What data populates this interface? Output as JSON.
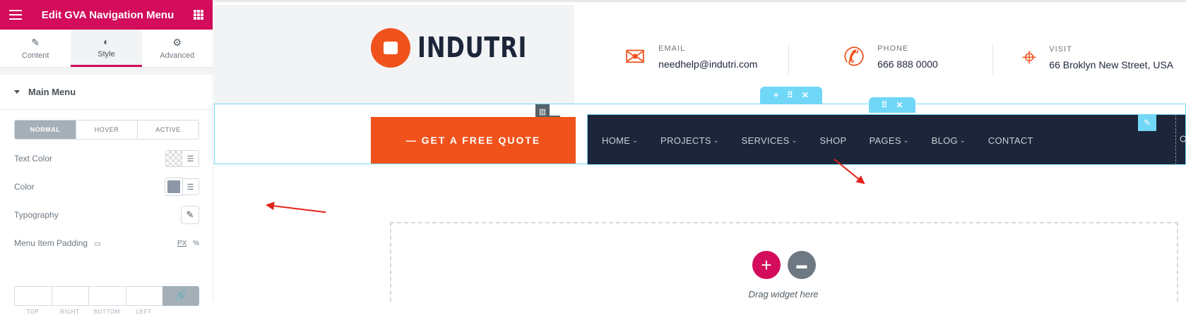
{
  "panel": {
    "title": "Edit GVA Navigation Menu",
    "tabs": [
      {
        "label": "Content",
        "icon": "pencil-icon"
      },
      {
        "label": "Style",
        "icon": "contrast-icon"
      },
      {
        "label": "Advanced",
        "icon": "gear-icon"
      }
    ],
    "section_title": "Main Menu",
    "state_tabs": [
      "NORMAL",
      "HOVER",
      "ACTIVE"
    ],
    "controls": {
      "text_color": "Text Color",
      "color": "Color",
      "typography": "Typography",
      "menu_item_padding": "Menu Item Padding",
      "unit_px": "PX",
      "unit_pct": "%"
    },
    "padding_labels": [
      "TOP",
      "RIGHT",
      "BOTTOM",
      "LEFT"
    ]
  },
  "preview": {
    "logo_text": "INDUTRI",
    "email": {
      "label": "EMAIL",
      "value": "needhelp@indutri.com"
    },
    "phone": {
      "label": "PHONE",
      "value": "666 888 0000"
    },
    "visit": {
      "label": "VISIT",
      "value": "66 Broklyn New Street, USA"
    },
    "quote_button": "— GET A FREE QUOTE",
    "nav": [
      {
        "label": "HOME",
        "dropdown": true
      },
      {
        "label": "PROJECTS",
        "dropdown": true
      },
      {
        "label": "SERVICES",
        "dropdown": true
      },
      {
        "label": "SHOP",
        "dropdown": false
      },
      {
        "label": "PAGES",
        "dropdown": true
      },
      {
        "label": "BLOG",
        "dropdown": true
      },
      {
        "label": "CONTACT",
        "dropdown": false
      }
    ],
    "drag_text": "Drag widget here"
  },
  "colors": {
    "brand": "#d30c5c",
    "accent": "#f0521c",
    "nav_bg": "#1c2539",
    "selection": "#71d7f7",
    "arrow": "#e2231a"
  }
}
